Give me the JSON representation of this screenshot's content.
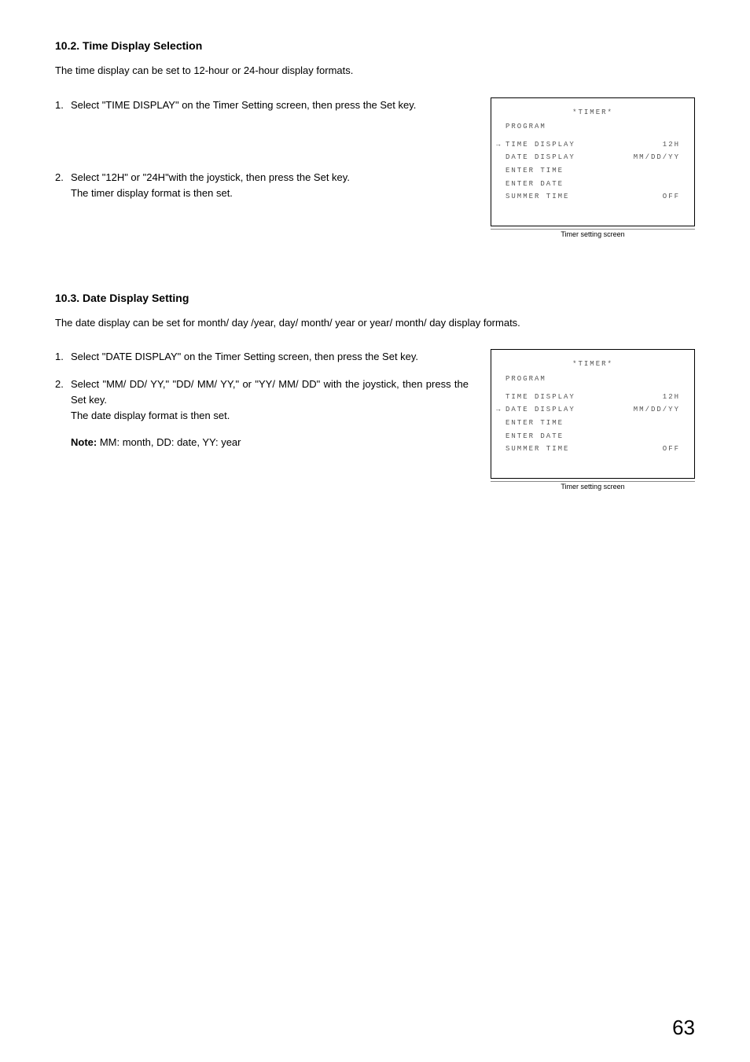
{
  "section1": {
    "heading": "10.2. Time Display Selection",
    "intro": "The time display can be set to 12-hour or 24-hour display formats.",
    "step1": "Select \"TIME DISPLAY\" on the Timer Setting screen, then press the Set key.",
    "step2_line1": "Select \"12H\" or \"24H\"with the joystick, then press the Set key.",
    "step2_line2": "The timer display format is then set."
  },
  "screen1": {
    "title": "*TIMER*",
    "program": "PROGRAM",
    "time_display": "TIME DISPLAY",
    "time_display_val": "12H",
    "date_display": "DATE DISPLAY",
    "date_display_val": "MM/DD/YY",
    "enter_time": "ENTER TIME",
    "enter_date": "ENTER DATE",
    "summer_time": "SUMMER TIME",
    "summer_time_val": "OFF",
    "caption": "Timer setting screen"
  },
  "section2": {
    "heading": "10.3. Date Display Setting",
    "intro": "The date display can be set for month/ day /year, day/ month/ year or year/ month/ day display formats.",
    "step1": "Select \"DATE DISPLAY\" on the Timer Setting screen, then press the Set key.",
    "step2_line1": "Select \"MM/ DD/ YY,\" \"DD/ MM/ YY,\" or \"YY/ MM/ DD\" with the joystick, then press the Set key.",
    "step2_line2": "The date display format is then set.",
    "note_label": "Note:",
    "note_text": " MM: month, DD: date, YY: year"
  },
  "screen2": {
    "title": "*TIMER*",
    "program": "PROGRAM",
    "time_display": "TIME DISPLAY",
    "time_display_val": "12H",
    "date_display": "DATE DISPLAY",
    "date_display_val": "MM/DD/YY",
    "enter_time": "ENTER TIME",
    "enter_date": "ENTER DATE",
    "summer_time": "SUMMER TIME",
    "summer_time_val": "OFF",
    "caption": "Timer setting screen"
  },
  "page_number": "63"
}
